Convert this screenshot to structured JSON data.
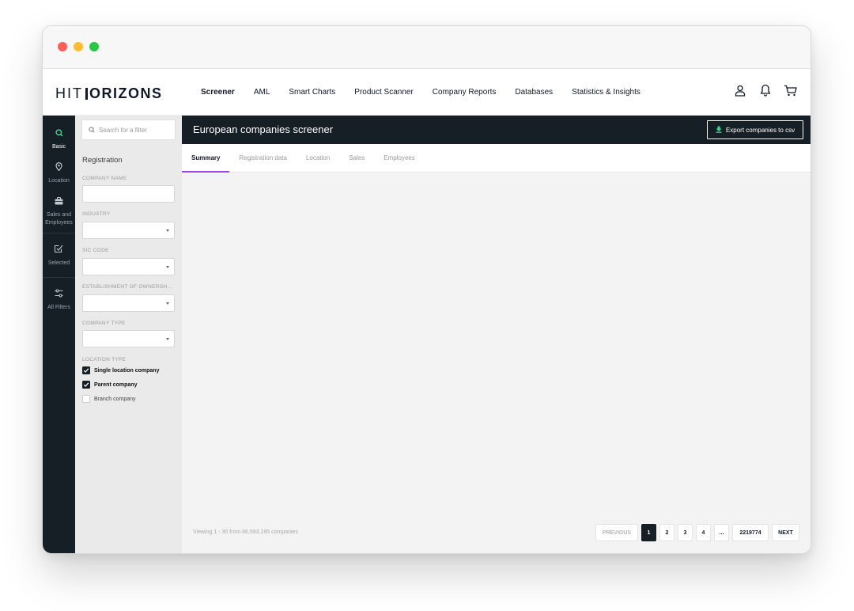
{
  "app": {
    "logo_text_light": "HIT",
    "logo_text_bold": "ORIZONS"
  },
  "topnav": {
    "items": [
      {
        "label": "Screener",
        "active": true
      },
      {
        "label": "AML"
      },
      {
        "label": "Smart Charts"
      },
      {
        "label": "Product Scanner"
      },
      {
        "label": "Company Reports"
      },
      {
        "label": "Databases"
      },
      {
        "label": "Statistics & Insights"
      }
    ],
    "icons": [
      "user-icon",
      "bell-icon",
      "cart-icon"
    ]
  },
  "leftrail": {
    "items": [
      {
        "label": "Basic",
        "icon": "search-icon",
        "active": true
      },
      {
        "label": "Location",
        "icon": "pin-icon"
      },
      {
        "label": "Sales and Employees",
        "icon": "briefcase-icon"
      },
      {
        "label": "Selected",
        "icon": "checkbox-edit-icon"
      },
      {
        "label": "All Filters",
        "icon": "sliders-icon"
      }
    ]
  },
  "filters": {
    "search_placeholder": "Search for a filter",
    "section_title": "Registration",
    "company_name_label": "COMPANY NAME",
    "industry_label": "INDUSTRY",
    "sic_code_label": "SIC CODE",
    "establishment_label": "ESTABLISHMENT OF OWNERSH...",
    "company_type_label": "COMPANY TYPE",
    "location_type_label": "LOCATION TYPE",
    "location_options": [
      {
        "label": "Single location company",
        "checked": true
      },
      {
        "label": "Parent company",
        "checked": true
      },
      {
        "label": "Branch company",
        "checked": false
      }
    ]
  },
  "main": {
    "title": "European companies screener",
    "export_label": "Export companies to csv",
    "tabs": [
      {
        "label": "Summary",
        "active": true
      },
      {
        "label": "Registration data"
      },
      {
        "label": "Location"
      },
      {
        "label": "Sales"
      },
      {
        "label": "Employees"
      }
    ],
    "viewing_text": "Viewing 1 - 30 from 66,593,195 companies",
    "pagination": {
      "previous": "PREVIOUS",
      "pages": [
        "1",
        "2",
        "3",
        "4"
      ],
      "current": "1",
      "ellipsis": "...",
      "last": "2219774",
      "next": "NEXT"
    }
  },
  "colors": {
    "dark": "#161e26",
    "accent_green": "#2ee08a",
    "tab_underline": "#a445ec",
    "panel_bg": "#eaeaea"
  }
}
